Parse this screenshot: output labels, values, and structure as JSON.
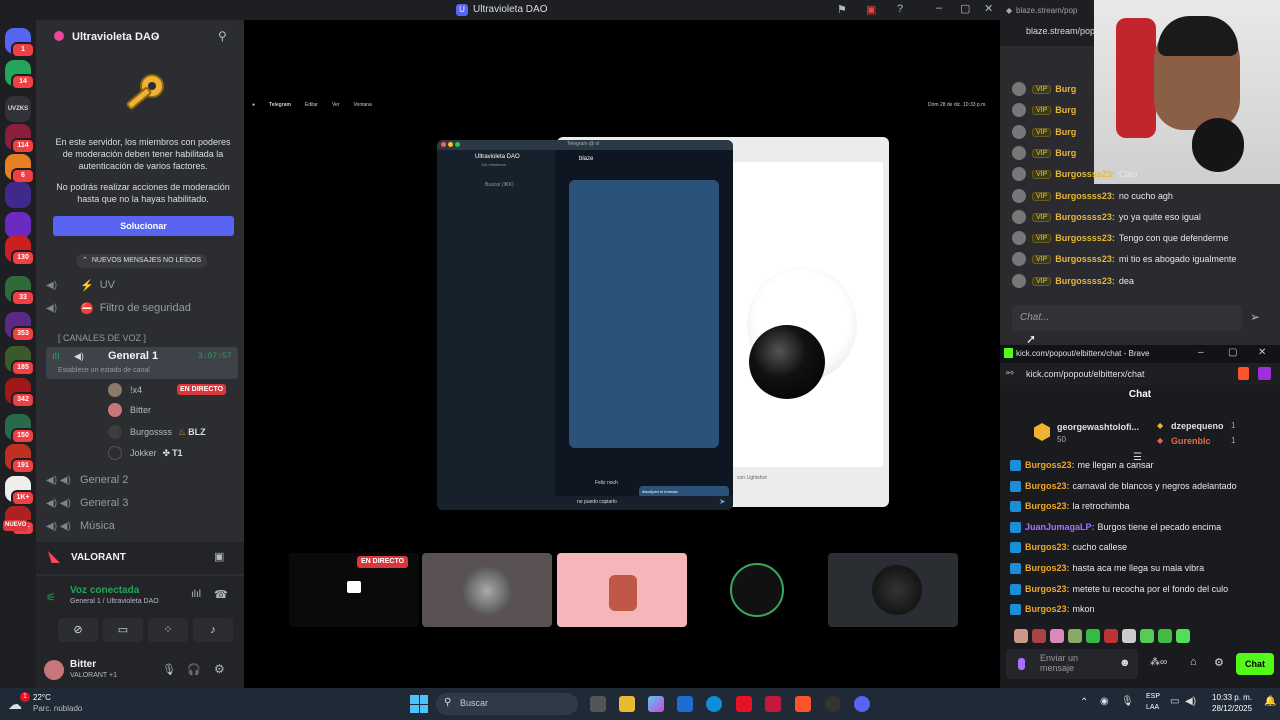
{
  "window": {
    "title": "Ultravioleta DAO"
  },
  "server_rail": {
    "items": [
      {
        "badge": "1",
        "color": "#5865f2"
      },
      {
        "badge": "14",
        "color": "#23a55a"
      },
      {
        "badge": "",
        "color": "#313338",
        "text": "UVZKS"
      },
      {
        "badge": "114",
        "color": "#8b1d3d"
      },
      {
        "badge": "6",
        "color": "#e67e22"
      },
      {
        "badge": "",
        "color": "#3f2a8c"
      },
      {
        "badge": "",
        "color": "#6b2bc2"
      },
      {
        "badge": "130",
        "color": "#cc2020"
      },
      {
        "badge": "33",
        "color": "#2f6b3a"
      },
      {
        "badge": "353",
        "color": "#5b2a87"
      },
      {
        "badge": "185",
        "color": "#3a5a2a"
      },
      {
        "badge": "342",
        "color": "#a01818"
      },
      {
        "badge": "150",
        "color": "#2a6a4a"
      },
      {
        "badge": "191",
        "color": "#c03020"
      },
      {
        "badge": "1K+",
        "color": "#eeeeee"
      },
      {
        "badge": "1K+",
        "color": "#b02020"
      }
    ],
    "nuevo_label": "NUEVO"
  },
  "channel_panel": {
    "server_name": "Ultravioleta DAO",
    "notice_line1": "En este servidor, los miembros con poderes de moderación deben tener habilitada la autenticación de varios factores.",
    "notice_line2": "No podrás realizar acciones de moderación hasta que no la hayas habilitado.",
    "solve_button": "Solucionar",
    "unread_pill": "NUEVOS MENSAJES NO LEÍDOS",
    "channels": [
      {
        "label": "UV",
        "emoji": "⚡"
      },
      {
        "label": "Filtro de seguridad",
        "emoji": "⛔"
      }
    ],
    "voice_category": "[ CANALES DE VOZ ]",
    "voice_active": {
      "label": "General 1",
      "timer": "3:07:57",
      "status_hint": "Establece un estado de canal"
    },
    "live_badge": "EN DIRECTO",
    "members": [
      {
        "name": "!x4",
        "extra": ""
      },
      {
        "name": "Bitter",
        "extra": ""
      },
      {
        "name": "Burgossss",
        "extra": "BLZ"
      },
      {
        "name": "Jokker",
        "extra": "T1"
      }
    ],
    "other_voice": [
      "General 2",
      "General 3",
      "Música"
    ]
  },
  "activity": {
    "game": "VALORANT"
  },
  "voice_status": {
    "title": "Voz conectada",
    "location": "General 1 / Ultravioleta DAO"
  },
  "user_panel": {
    "name": "Bitter",
    "status": "VALORANT +1"
  },
  "stream": {
    "live_badge": "EN DIRECTO",
    "mac_menu": [
      "Telegram",
      "Editar",
      "Ver",
      "Ventana"
    ],
    "mac_clock": "Dom 28 de dic.  10:33 p.m.",
    "telegram": {
      "title": "Telegram @ ol",
      "group": "Ultravioleta DAO",
      "group_sub": "118 miembros",
      "search": "Buscar (⌘K)",
      "chat_title": "blaze",
      "chats": [
        "General",
        "blaze",
        "Trading",
        "Engage",
        "hacks-and-exploits",
        "Avalanche",
        "scams",
        "Tecnologías - Tech",
        "MONAD",
        "Airdrops y refaridos",
        "Team 1"
      ],
      "reply_text": "Feliz noch",
      "bubble_text": "discúlpen el formato",
      "input_text": "no puedo copiarlo"
    },
    "lightshot_caption": "con Lightshot"
  },
  "blaze": {
    "url": "blaze.stream/pop",
    "url_full": "blaze.stream/pop",
    "vip_label": "VIP",
    "messages": [
      {
        "user": "Burg",
        "text": ""
      },
      {
        "user": "Burg",
        "text": ""
      },
      {
        "user": "Burg",
        "text": ""
      },
      {
        "user": "Burg",
        "text": ""
      },
      {
        "user": "Burgossss23:",
        "text": "Clap"
      },
      {
        "user": "Burgossss23:",
        "text": "no cucho agh"
      },
      {
        "user": "Burgossss23:",
        "text": "yo ya quite eso igual"
      },
      {
        "user": "Burgossss23:",
        "text": "Tengo con que defenderme"
      },
      {
        "user": "Burgossss23:",
        "text": "mi tio es abogado igualmente"
      },
      {
        "user": "Burgossss23:",
        "text": "dea"
      }
    ],
    "placeholder": "Chat..."
  },
  "kick": {
    "window_title": "kick.com/popout/elbitterx/chat - Brave",
    "url": "kick.com/popout/elbitterx/chat",
    "header": "Chat",
    "top_gifter": {
      "name": "georgewashtolofi...",
      "count": "50"
    },
    "gifters": [
      {
        "name": "dzepequeno",
        "count": "1"
      },
      {
        "name": "Gurenblc",
        "count": "1"
      }
    ],
    "messages": [
      {
        "user": "Burgoss23:",
        "text": "me llegan a cansar",
        "color": "#f0a727"
      },
      {
        "user": "Burgos23:",
        "text": "carnaval de blancos y negros adelantado",
        "color": "#f0a727"
      },
      {
        "user": "Burgos23:",
        "text": "la retrochimba",
        "color": "#f0a727"
      },
      {
        "user": "JuanJumagaLP:",
        "text": "Burgos tiene el pecado encima",
        "color": "#a970ff"
      },
      {
        "user": "Burgos23:",
        "text": "cucho callese",
        "color": "#f0a727"
      },
      {
        "user": "Burgos23:",
        "text": "hasta aca me llega su mala vibra",
        "color": "#f0a727"
      },
      {
        "user": "Burgos23:",
        "text": "metete tu recocha por el fondo del culo",
        "color": "#f0a727"
      },
      {
        "user": "Burgos23:",
        "text": "mkon",
        "color": "#f0a727"
      }
    ],
    "input_placeholder": "Enviar un mensaje",
    "chat_button": "Chat"
  },
  "taskbar": {
    "weather_temp": "22°C",
    "weather_desc": "Parc. nublado",
    "search_placeholder": "Buscar",
    "lang_top": "ESP",
    "lang_bottom": "LAA",
    "time": "10:33 p. m.",
    "date": "28/12/2025"
  }
}
